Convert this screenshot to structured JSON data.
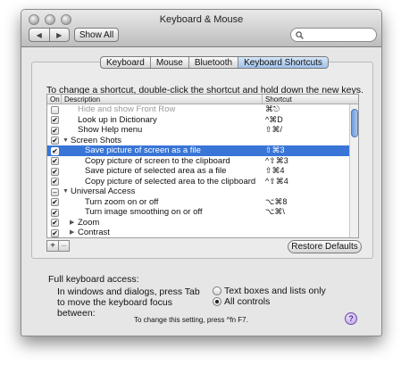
{
  "window": {
    "title": "Keyboard & Mouse"
  },
  "toolbar": {
    "back_glyph": "◀",
    "forward_glyph": "▶",
    "show_all": "Show All",
    "search_value": ""
  },
  "tabs": [
    {
      "label": "Keyboard",
      "active": false
    },
    {
      "label": "Mouse",
      "active": false
    },
    {
      "label": "Bluetooth",
      "active": false
    },
    {
      "label": "Keyboard Shortcuts",
      "active": true
    }
  ],
  "instruction": "To change a shortcut, double-click the shortcut and hold down the new keys.",
  "table": {
    "headers": {
      "on": "On",
      "description": "Description",
      "shortcut": "Shortcut"
    },
    "rows": [
      {
        "check": "",
        "description": "Hide and show Front Row",
        "shortcut": "⌘⎋",
        "indent": 1,
        "gray": true
      },
      {
        "check": "✔",
        "description": "Look up in Dictionary",
        "shortcut": "^⌘D",
        "indent": 1
      },
      {
        "check": "✔",
        "description": "Show Help menu",
        "shortcut": "⇧⌘/",
        "indent": 1
      },
      {
        "check": "✔",
        "description": "Screen Shots",
        "shortcut": "",
        "indent": 0,
        "tri": "▼"
      },
      {
        "check": "✔",
        "description": "Save picture of screen as a file",
        "shortcut": "⇧⌘3",
        "indent": 2,
        "selected": true
      },
      {
        "check": "✔",
        "description": "Copy picture of screen to the clipboard",
        "shortcut": "^⇧⌘3",
        "indent": 2
      },
      {
        "check": "✔",
        "description": "Save picture of selected area as a file",
        "shortcut": "⇧⌘4",
        "indent": 2
      },
      {
        "check": "✔",
        "description": "Copy picture of selected area to the clipboard",
        "shortcut": "^⇧⌘4",
        "indent": 2
      },
      {
        "check": "–",
        "description": "Universal Access",
        "shortcut": "",
        "indent": 0,
        "tri": "▼"
      },
      {
        "check": "✔",
        "description": "Turn zoom on or off",
        "shortcut": "⌥⌘8",
        "indent": 2
      },
      {
        "check": "✔",
        "description": "Turn image smoothing on or off",
        "shortcut": "⌥⌘\\",
        "indent": 2
      },
      {
        "check": "✔",
        "description": "Zoom",
        "shortcut": "",
        "indent": 1,
        "tri": "▶"
      },
      {
        "check": "✔",
        "description": "Contrast",
        "shortcut": "",
        "indent": 1,
        "tri": "▶"
      }
    ]
  },
  "buttons": {
    "plus": "+",
    "minus": "–",
    "restore_defaults": "Restore Defaults"
  },
  "full_keyboard_access": {
    "label": "Full keyboard access:",
    "description": "In windows and dialogs, press Tab to move the keyboard focus between:",
    "options": [
      {
        "label": "Text boxes and lists only",
        "selected": false
      },
      {
        "label": "All controls",
        "selected": true
      }
    ],
    "note": "To change this setting, press ^fn F7."
  },
  "help": {
    "glyph": "?"
  },
  "colors": {
    "selection": "#3875d7",
    "active_tab": "#9fc1ea"
  }
}
